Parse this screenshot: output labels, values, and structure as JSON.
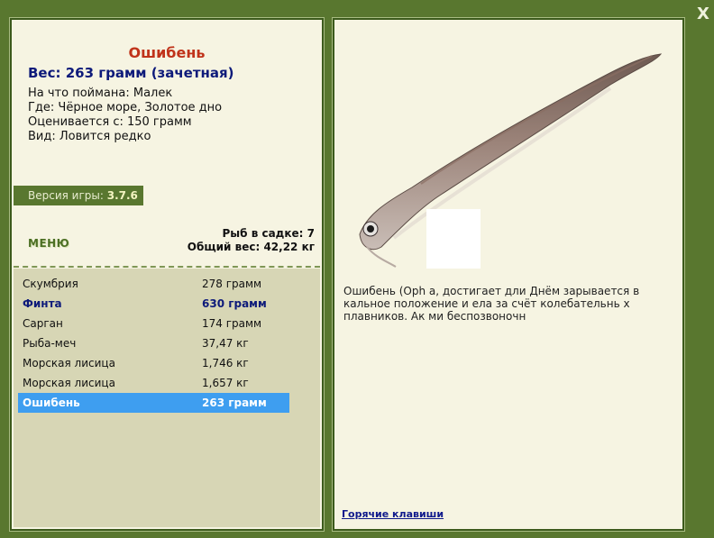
{
  "close_label": "X",
  "fish": {
    "name": "Ошибень",
    "weight_line": "Вес: 263 грамм (зачетная)",
    "caught_on": "На что поймана: Малек",
    "where": "Где: Чёрное море, Золотое дно",
    "valued_from": "Оценивается с: 150 грамм",
    "kind": "Вид: Ловится редко"
  },
  "version": {
    "label": "Версия игры:",
    "value": "3.7.6"
  },
  "menu_label": "МЕНЮ",
  "sadok": {
    "count": "Рыб в садке: 7",
    "total": "Общий вес: 42,22 кг"
  },
  "catch_list": [
    {
      "name": "Скумбрия",
      "weight": "278 грамм"
    },
    {
      "name": "Финта",
      "weight": "630 грамм"
    },
    {
      "name": "Сарган",
      "weight": "174 грамм"
    },
    {
      "name": "Рыба-меч",
      "weight": "37,47 кг"
    },
    {
      "name": "Морская лисица",
      "weight": "1,746 кг"
    },
    {
      "name": "Морская лисица",
      "weight": "1,657 кг"
    },
    {
      "name": "Ошибень",
      "weight": "263 грамм"
    }
  ],
  "description": "Ошибень (Oph                                                   а, достигает дли                                                 Днём зарывается в                                              кальное положение и                                           ела за счёт колебательнь                                              х плавников. Ак                                                 ми беспозвоночн",
  "hotkeys_label": "Горячие клавиши",
  "colors": {
    "frame": "#59772f",
    "panel": "#f6f4e2",
    "title": "#c0331a",
    "weight": "#0d1a7a",
    "selection": "#3e9ef0"
  }
}
